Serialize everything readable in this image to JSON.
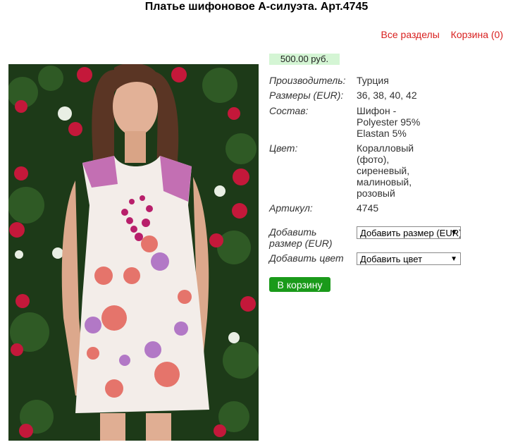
{
  "page": {
    "title": "Платье шифоновое А-силуэта. Арт.4745"
  },
  "nav": {
    "all_sections": "Все разделы",
    "cart": "Корзина (0)"
  },
  "product": {
    "price": "500.00 руб.",
    "props": {
      "maker_label": "Производитель:",
      "maker_value": "Турция",
      "sizes_label": "Размеры (EUR):",
      "sizes_value": "36, 38, 40, 42",
      "composition_label": "Состав:",
      "composition_line1": "Шифон -",
      "composition_line2": "Polyester 95%",
      "composition_line3": "Elastan 5%",
      "color_label": "Цвет:",
      "color_line1": "Коралловый",
      "color_line2": "(фото),",
      "color_line3": "сиреневый,",
      "color_line4": "малиновый,",
      "color_line5": "розовый",
      "article_label": "Артикул:",
      "article_value": "4745"
    },
    "add_size_label_line1": "Добавить",
    "add_size_label_line2": "размер (EUR)",
    "add_size_select": "Добавить размер (EUR)",
    "add_color_label": "Добавить цвет",
    "add_color_select": "Добавить цвет",
    "cart_button": "В корзину"
  },
  "colors": {
    "nav_link": "#d8201f",
    "price_bg": "#d4f5d4",
    "cart_button_bg": "#1a9a1a"
  }
}
